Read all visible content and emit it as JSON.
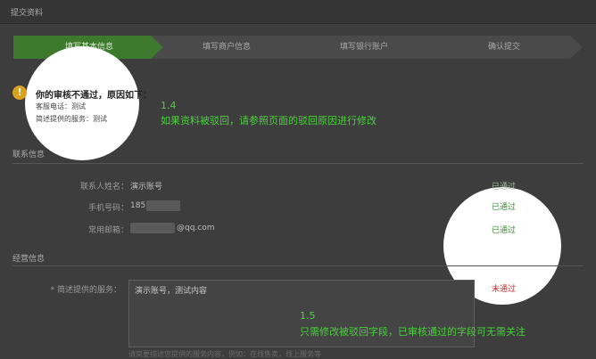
{
  "window": {
    "title": "提交资料"
  },
  "steps": [
    "填写基本信息",
    "填写商户信息",
    "填写银行账户",
    "确认提交"
  ],
  "notice": {
    "title": "你的审核不通过，原因如下：",
    "lines": [
      "客服电话：测试",
      "简述提供的服务：测试"
    ]
  },
  "annotations": {
    "a14": {
      "number": "1.4",
      "text": "如果资料被驳回，请参照页面的驳回原因进行修改"
    },
    "a15": {
      "number": "1.5",
      "text": "只需修改被驳回字段，已审核通过的字段可无需关注"
    }
  },
  "contact": {
    "section_title": "联系信息",
    "fields": [
      {
        "label": "联系人姓名：",
        "value": "演示账号",
        "status": "已通过"
      },
      {
        "label": "手机号码：",
        "value": "185",
        "status": "已通过"
      },
      {
        "label": "常用邮箱：",
        "value": "@qq.com",
        "status": "已通过"
      }
    ]
  },
  "business": {
    "section_title": "经营信息",
    "field_label": "* 简述提供的服务：",
    "field_value": "演示账号，测试内容",
    "status": "未通过",
    "help_text": "请简要描述您提供的服务内容，例如：在线售卖，线上服务等"
  },
  "colors": {
    "active_step": "#3e7a2e",
    "pass": "#3d8f37",
    "fail": "#c62b2b",
    "annotation": "#49d13a",
    "warning_icon": "#d9a21f"
  }
}
